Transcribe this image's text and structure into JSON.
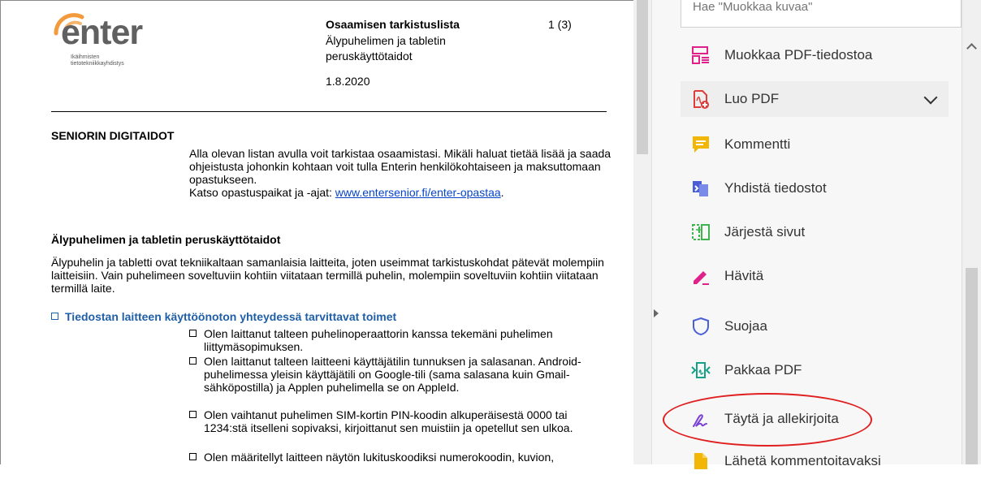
{
  "document": {
    "logo": {
      "text": "enter",
      "subtitle": "Ikäihmisten\ntietotekniikkayhdistys"
    },
    "header": {
      "title": "Osaamisen tarkistuslista",
      "page": "1 (3)",
      "subtitle": "Älypuhelimen ja tabletin peruskäyttötaidot",
      "date": "1.8.2020"
    },
    "section_title": "SENIORIN DIGITAIDOT",
    "intro": "Alla olevan listan avulla voit tarkistaa osaamistasi. Mikäli haluat tietää lisää ja saada ohjeistusta johonkin kohtaan voit tulla Enterin henkilökohtaiseen ja maksuttomaan opastukseen.",
    "intro_link_prefix": "Katso opastuspaikat ja -ajat: ",
    "intro_link": "www.entersenior.fi/enter-opastaa",
    "intro_link_suffix": ".",
    "heading2": "Älypuhelimen ja tabletin peruskäyttötaidot",
    "paragraph": "Älypuhelin ja tabletti ovat tekniikaltaan samanlaisia laitteita, joten useimmat tarkistuskohdat pätevät molempiin laitteisiin. Vain puhelimeen soveltuviin kohtiin viitataan termillä puhelin, molempiin soveltuviin kohtiin viitataan termillä laite.",
    "checklist_heading": "Tiedostan laitteen käyttöönoton yhteydessä tarvittavat toimet",
    "items": [
      "Olen laittanut talteen puhelinoperaattorin kanssa tekemäni puhelimen liittymäsopimuksen.",
      "Olen laittanut talteen laitteeni käyttäjätilin tunnuksen ja salasanan. Android-puhelimessa yleisin käyttäjätili on Google-tili (sama salasana kuin Gmail-sähköpostilla) ja Applen puhelimella se on AppleId.",
      "Olen vaihtanut puhelimen SIM-kortin PIN-koodin alkuperäisestä 0000 tai 1234:stä itselleni sopivaksi, kirjoittanut sen muistiin ja opetellut sen ulkoa.",
      "Olen määritellyt laitteen näytön lukituskoodiksi numerokoodin, kuvion,"
    ]
  },
  "tools_panel": {
    "search_placeholder": "Hae \"Muokkaa kuvaa\"",
    "tools": [
      {
        "label": "Muokkaa PDF-tiedostoa",
        "icon": "edit-pdf-icon"
      },
      {
        "label": "Luo PDF",
        "icon": "create-pdf-icon"
      },
      {
        "label": "Kommentti",
        "icon": "comment-icon"
      },
      {
        "label": "Yhdistä tiedostot",
        "icon": "combine-files-icon"
      },
      {
        "label": "Järjestä sivut",
        "icon": "organize-pages-icon"
      },
      {
        "label": "Hävitä",
        "icon": "redact-icon"
      },
      {
        "label": "Suojaa",
        "icon": "protect-icon"
      },
      {
        "label": "Pakkaa PDF",
        "icon": "compress-pdf-icon"
      },
      {
        "label": "Täytä ja allekirjoita",
        "icon": "fill-sign-icon"
      },
      {
        "label": "Lähetä kommentoitavaksi",
        "icon": "send-for-comments-icon"
      }
    ]
  },
  "colors": {
    "accent_orange": "#f39a3c",
    "link_blue": "#0645c8",
    "checklist_blue": "#1f5fa8",
    "highlight_red": "#e02020"
  }
}
